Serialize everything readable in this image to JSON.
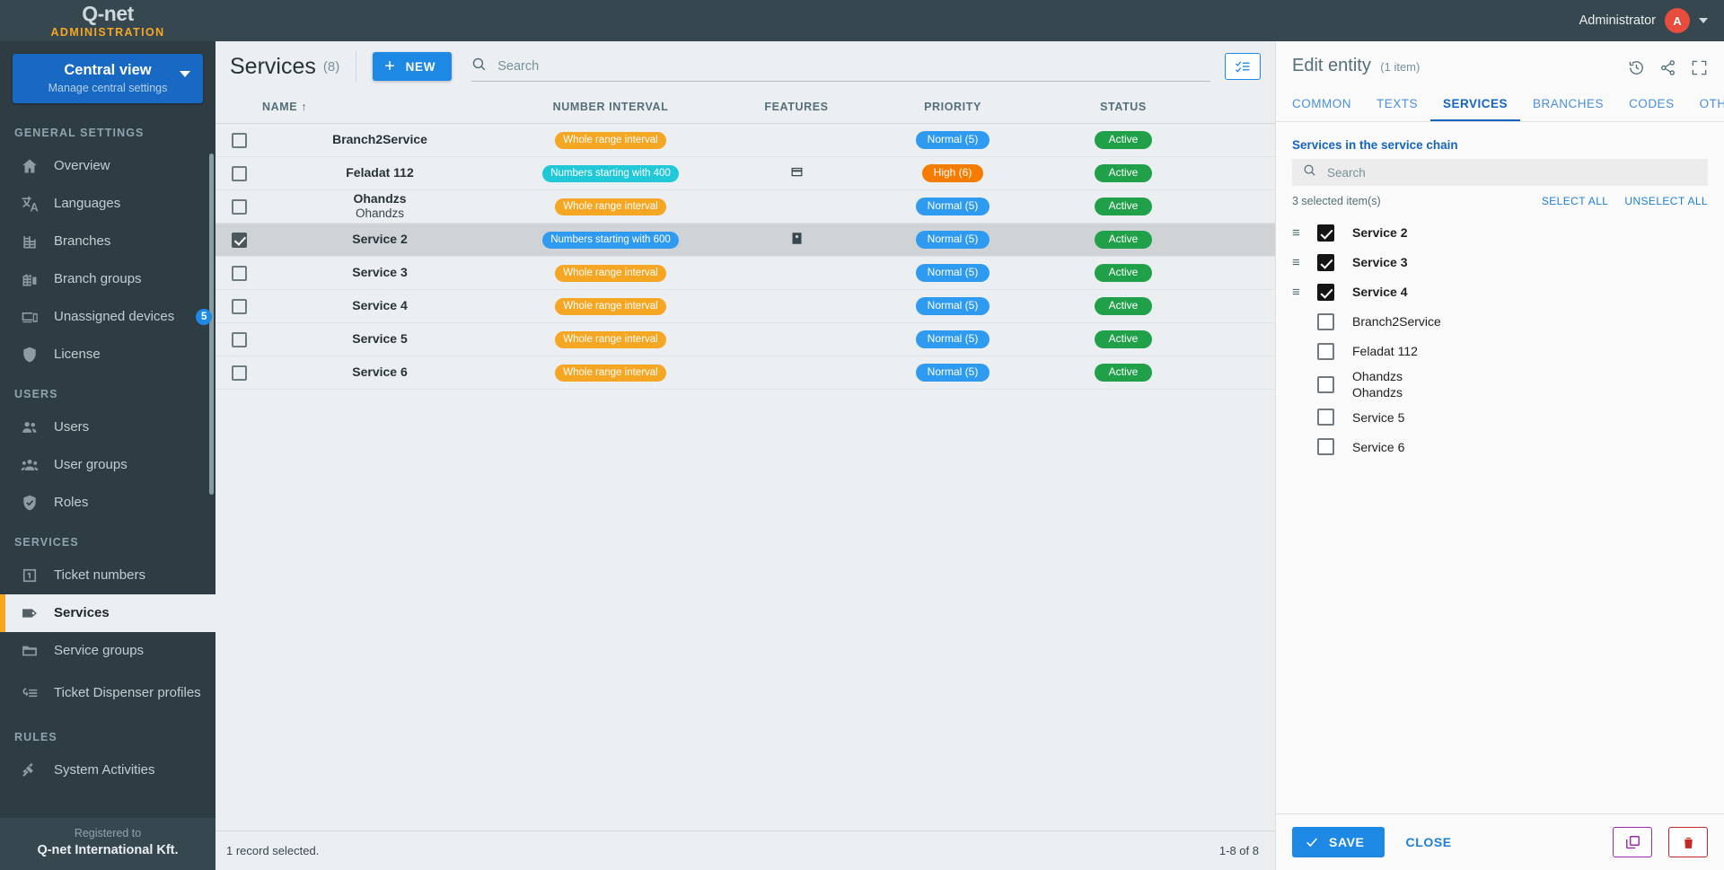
{
  "topbar": {
    "brand_logo": "Q-net",
    "brand_sub": "ADMINISTRATION",
    "user_name": "Administrator",
    "avatar_initial": "A"
  },
  "sidebar": {
    "view_select": {
      "title": "Central view",
      "subtitle": "Manage central settings"
    },
    "sections": [
      {
        "title": "GENERAL SETTINGS",
        "items": [
          {
            "label": "Overview",
            "icon": "home-icon",
            "badge": null,
            "active": false
          },
          {
            "label": "Languages",
            "icon": "translate-icon",
            "badge": null,
            "active": false
          },
          {
            "label": "Branches",
            "icon": "building-icon",
            "badge": null,
            "active": false
          },
          {
            "label": "Branch groups",
            "icon": "buildings-icon",
            "badge": null,
            "active": false
          },
          {
            "label": "Unassigned devices",
            "icon": "devices-icon",
            "badge": "5",
            "active": false
          },
          {
            "label": "License",
            "icon": "shield-icon",
            "badge": null,
            "active": false
          }
        ]
      },
      {
        "title": "USERS",
        "items": [
          {
            "label": "Users",
            "icon": "users-icon",
            "badge": null,
            "active": false
          },
          {
            "label": "User groups",
            "icon": "user-group-icon",
            "badge": null,
            "active": false
          },
          {
            "label": "Roles",
            "icon": "shield-check-icon",
            "badge": null,
            "active": false
          }
        ]
      },
      {
        "title": "SERVICES",
        "items": [
          {
            "label": "Ticket numbers",
            "icon": "number-one-icon",
            "badge": null,
            "active": false
          },
          {
            "label": "Services",
            "icon": "tag-icon",
            "badge": null,
            "active": true
          },
          {
            "label": "Service groups",
            "icon": "folder-icon",
            "badge": null,
            "active": false
          },
          {
            "label": "Ticket Dispenser profiles",
            "icon": "dispenser-icon",
            "badge": null,
            "active": false
          }
        ]
      },
      {
        "title": "RULES",
        "items": [
          {
            "label": "System Activities",
            "icon": "gavel-icon",
            "badge": null,
            "active": false
          }
        ]
      }
    ],
    "footer": {
      "registered_to_label": "Registered to",
      "organization": "Q-net International Kft."
    }
  },
  "main": {
    "title": "Services",
    "count": "(8)",
    "new_button": "NEW",
    "search_placeholder": "Search",
    "search_value": "",
    "column_selector_icon": "checklist-icon",
    "columns": [
      "NAME",
      "NUMBER INTERVAL",
      "FEATURES",
      "PRIORITY",
      "STATUS"
    ],
    "sort_indicator": "↑",
    "rows": [
      {
        "checked": false,
        "selected": false,
        "name": "Branch2Service",
        "name_sub": "",
        "interval": "Whole range interval",
        "interval_color": "orange",
        "feature_icon": "",
        "priority": "Normal (5)",
        "priority_level": "normal",
        "status": "Active"
      },
      {
        "checked": false,
        "selected": false,
        "name": "Feladat 112",
        "name_sub": "",
        "interval": "Numbers starting with 400",
        "interval_color": "cyan",
        "feature_icon": "card-icon",
        "priority": "High (6)",
        "priority_level": "high",
        "status": "Active"
      },
      {
        "checked": false,
        "selected": false,
        "name": "Ohandzs",
        "name_sub": "Ohandzs",
        "interval": "Whole range interval",
        "interval_color": "orange",
        "feature_icon": "",
        "priority": "Normal (5)",
        "priority_level": "normal",
        "status": "Active"
      },
      {
        "checked": true,
        "selected": true,
        "name": "Service 2",
        "name_sub": "",
        "interval": "Numbers starting with 600",
        "interval_color": "blue",
        "feature_icon": "id-card-icon",
        "priority": "Normal (5)",
        "priority_level": "normal",
        "status": "Active"
      },
      {
        "checked": false,
        "selected": false,
        "name": "Service 3",
        "name_sub": "",
        "interval": "Whole range interval",
        "interval_color": "orange",
        "feature_icon": "",
        "priority": "Normal (5)",
        "priority_level": "normal",
        "status": "Active"
      },
      {
        "checked": false,
        "selected": false,
        "name": "Service 4",
        "name_sub": "",
        "interval": "Whole range interval",
        "interval_color": "orange",
        "feature_icon": "",
        "priority": "Normal (5)",
        "priority_level": "normal",
        "status": "Active"
      },
      {
        "checked": false,
        "selected": false,
        "name": "Service 5",
        "name_sub": "",
        "interval": "Whole range interval",
        "interval_color": "orange",
        "feature_icon": "",
        "priority": "Normal (5)",
        "priority_level": "normal",
        "status": "Active"
      },
      {
        "checked": false,
        "selected": false,
        "name": "Service 6",
        "name_sub": "",
        "interval": "Whole range interval",
        "interval_color": "orange",
        "feature_icon": "",
        "priority": "Normal (5)",
        "priority_level": "normal",
        "status": "Active"
      }
    ],
    "statusbar": {
      "selection_text": "1 record selected.",
      "pagination": "1-8 of 8"
    }
  },
  "right_panel": {
    "title": "Edit entity",
    "count": "(1 item)",
    "head_icons": [
      "history-icon",
      "share-icon",
      "fullscreen-icon"
    ],
    "tabs": [
      {
        "label": "COMMON",
        "active": false
      },
      {
        "label": "TEXTS",
        "active": false
      },
      {
        "label": "SERVICES",
        "active": true
      },
      {
        "label": "BRANCHES",
        "active": false
      },
      {
        "label": "CODES",
        "active": false
      },
      {
        "label": "OTHERS",
        "active": false
      }
    ],
    "section_label": "Services in the service chain",
    "search_placeholder": "Search",
    "search_value": "",
    "selected_count_text": "3 selected item(s)",
    "select_all_label": "SELECT ALL",
    "unselect_all_label": "UNSELECT ALL",
    "items": [
      {
        "label": "Service 2",
        "label_sub": "",
        "checked": true,
        "draggable": true
      },
      {
        "label": "Service 3",
        "label_sub": "",
        "checked": true,
        "draggable": true
      },
      {
        "label": "Service 4",
        "label_sub": "",
        "checked": true,
        "draggable": true
      },
      {
        "label": "Branch2Service",
        "label_sub": "",
        "checked": false,
        "draggable": false
      },
      {
        "label": "Feladat 112",
        "label_sub": "",
        "checked": false,
        "draggable": false
      },
      {
        "label": "Ohandzs",
        "label_sub": "Ohandzs",
        "checked": false,
        "draggable": false
      },
      {
        "label": "Service 5",
        "label_sub": "",
        "checked": false,
        "draggable": false
      },
      {
        "label": "Service 6",
        "label_sub": "",
        "checked": false,
        "draggable": false
      }
    ],
    "footer": {
      "save_label": "SAVE",
      "close_label": "CLOSE",
      "copy_icon": "copy-icon",
      "delete_icon": "trash-icon"
    }
  }
}
